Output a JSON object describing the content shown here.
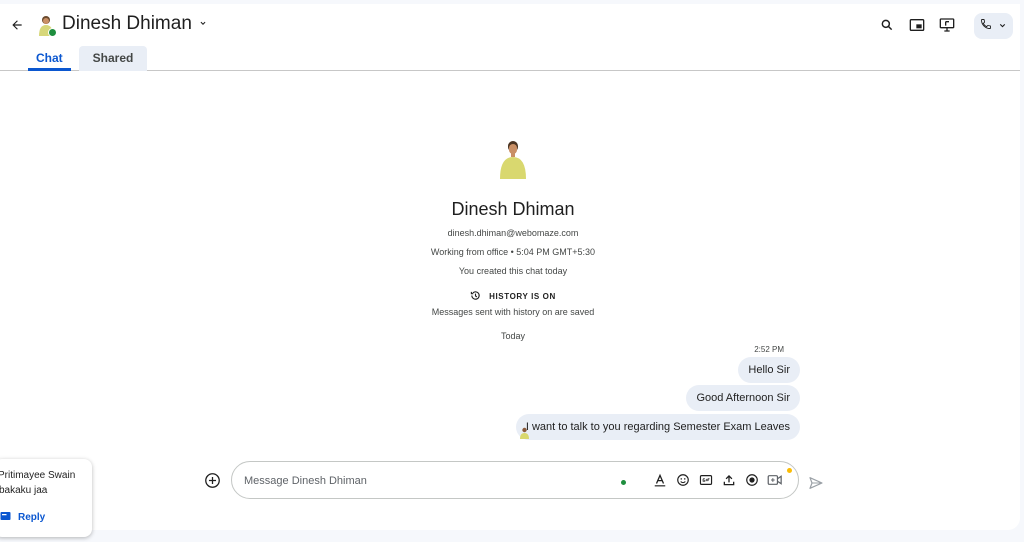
{
  "header": {
    "contact_name": "Dinesh Dhiman",
    "tabs": [
      {
        "label": "Chat",
        "active": true
      },
      {
        "label": "Shared",
        "active": false
      }
    ],
    "icons": [
      "back-arrow-icon",
      "search-icon",
      "picture-in-picture-icon",
      "present-icon",
      "phone-icon",
      "chevron-down-icon"
    ]
  },
  "intro": {
    "name": "Dinesh Dhiman",
    "email": "dinesh.dhiman@webomaze.com",
    "status": "Working from office • 5:04 PM GMT+5:30",
    "created": "You created this chat today",
    "history_title": "HISTORY IS ON",
    "history_sub": "Messages sent with history on are saved",
    "day_label": "Today"
  },
  "messages": {
    "time": "2:52 PM",
    "items": [
      "Hello Sir",
      "Good Afternoon Sir",
      "I want to talk to you regarding Semester Exam Leaves"
    ]
  },
  "composer": {
    "placeholder": "Message Dinesh Dhiman",
    "tools": [
      "format-text-icon",
      "emoji-icon",
      "gif-icon",
      "upload-icon",
      "record-video-icon",
      "meet-icon"
    ]
  },
  "notification": {
    "sender": "Pritimayee Swain",
    "text": "bakaku jaa",
    "reply_label": "Reply"
  },
  "colors": {
    "accent": "#0b57d0",
    "bubble": "#e9eef6",
    "presence": "#1e8e3e"
  }
}
